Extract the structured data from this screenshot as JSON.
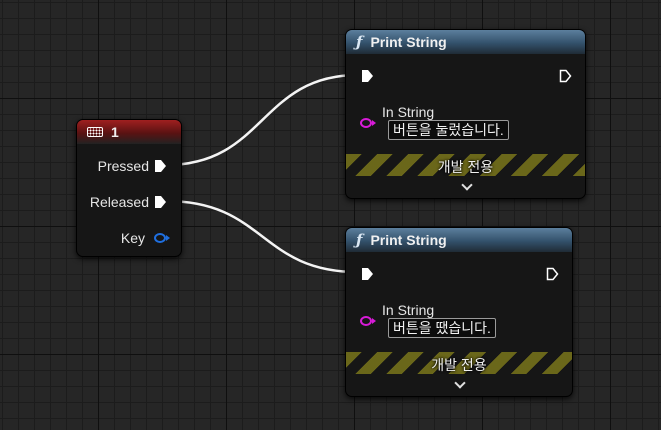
{
  "key_node": {
    "title": "1",
    "pins": {
      "pressed": "Pressed",
      "released": "Released",
      "key": "Key"
    },
    "header_color": "#a02020"
  },
  "print_nodes": [
    {
      "title": "Print String",
      "in_string_label": "In String",
      "in_string_value": "버튼을 눌렀습니다.",
      "dev_label": "개발 전용"
    },
    {
      "title": "Print String",
      "in_string_label": "In String",
      "in_string_value": "버튼을 땠습니다.",
      "dev_label": "개발 전용"
    }
  ],
  "colors": {
    "function_header": "#33516b",
    "string_pin": "#d81bd8",
    "key_pin": "#1f6fe0",
    "exec_wire": "#ffffff",
    "dev_stripe": "#6f6b1a"
  }
}
